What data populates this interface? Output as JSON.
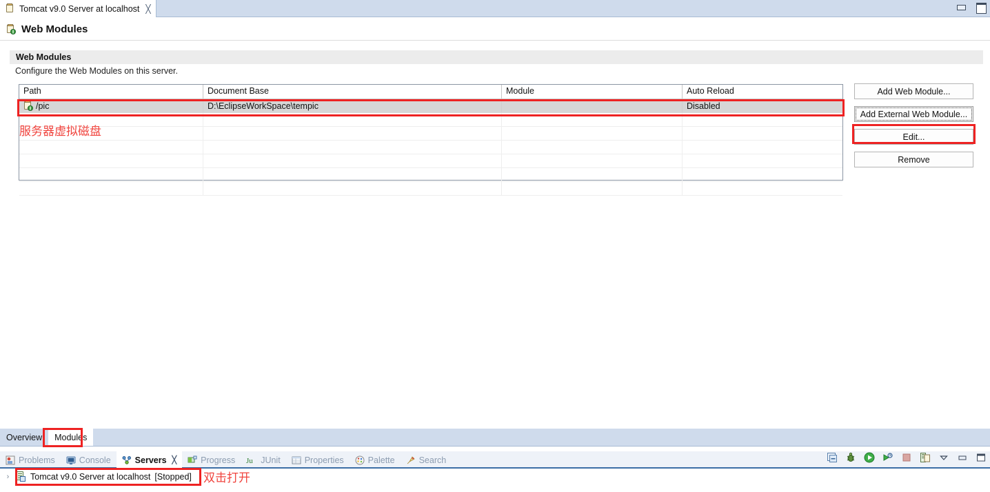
{
  "editor": {
    "tab_title": "Tomcat v9.0 Server at localhost",
    "tab_close_glyph": "╳",
    "form_title": "Web Modules"
  },
  "window_controls": {
    "minimize": "minimize",
    "maximize": "maximize"
  },
  "section": {
    "title": "Web Modules",
    "description": "Configure the Web Modules on this server."
  },
  "table": {
    "columns": [
      "Path",
      "Document Base",
      "Module",
      "Auto Reload"
    ],
    "rows": [
      {
        "path": "/pic",
        "document_base": "D:\\EclipseWorkSpace\\tempic",
        "module": "",
        "auto_reload": "Disabled",
        "selected": true
      }
    ],
    "empty_row_count": 6
  },
  "side_buttons": [
    {
      "label": "Add Web Module...",
      "focused": false
    },
    {
      "label": "Add External Web Module...",
      "focused": true
    },
    {
      "label": "Edit...",
      "focused": false
    },
    {
      "label": "Remove",
      "focused": false
    }
  ],
  "annotations": {
    "virtual_disk_note": "服务器虚拟磁盘",
    "double_click_note": "双击打开"
  },
  "editor_bottom_tabs": [
    {
      "label": "Overview",
      "active": false
    },
    {
      "label": "Modules",
      "active": true
    }
  ],
  "views": {
    "tabs": [
      {
        "label": "Problems",
        "icon": "problems-icon",
        "active": false
      },
      {
        "label": "Console",
        "icon": "console-icon",
        "active": false
      },
      {
        "label": "Servers",
        "icon": "servers-icon",
        "active": true,
        "close_glyph": "╳"
      },
      {
        "label": "Progress",
        "icon": "progress-icon",
        "active": false
      },
      {
        "label": "JUnit",
        "icon": "junit-icon",
        "active": false
      },
      {
        "label": "Properties",
        "icon": "properties-icon",
        "active": false
      },
      {
        "label": "Palette",
        "icon": "palette-icon",
        "active": false
      },
      {
        "label": "Search",
        "icon": "search-icon",
        "active": false
      }
    ],
    "toolbar_icons": [
      "collapse-all-icon",
      "debug-icon",
      "start-icon",
      "profile-icon",
      "stop-icon",
      "publish-icon",
      "view-menu-icon",
      "minimize-view-icon",
      "maximize-view-icon"
    ]
  },
  "servers": {
    "row": {
      "name": "Tomcat v9.0 Server at localhost",
      "status": "[Stopped]",
      "expander": "›"
    }
  },
  "colors": {
    "accent": "#3b6ea5",
    "tabbar": "#cfdbec",
    "annotation_red": "#ee2222",
    "selection_gray": "#d6d6d6"
  }
}
